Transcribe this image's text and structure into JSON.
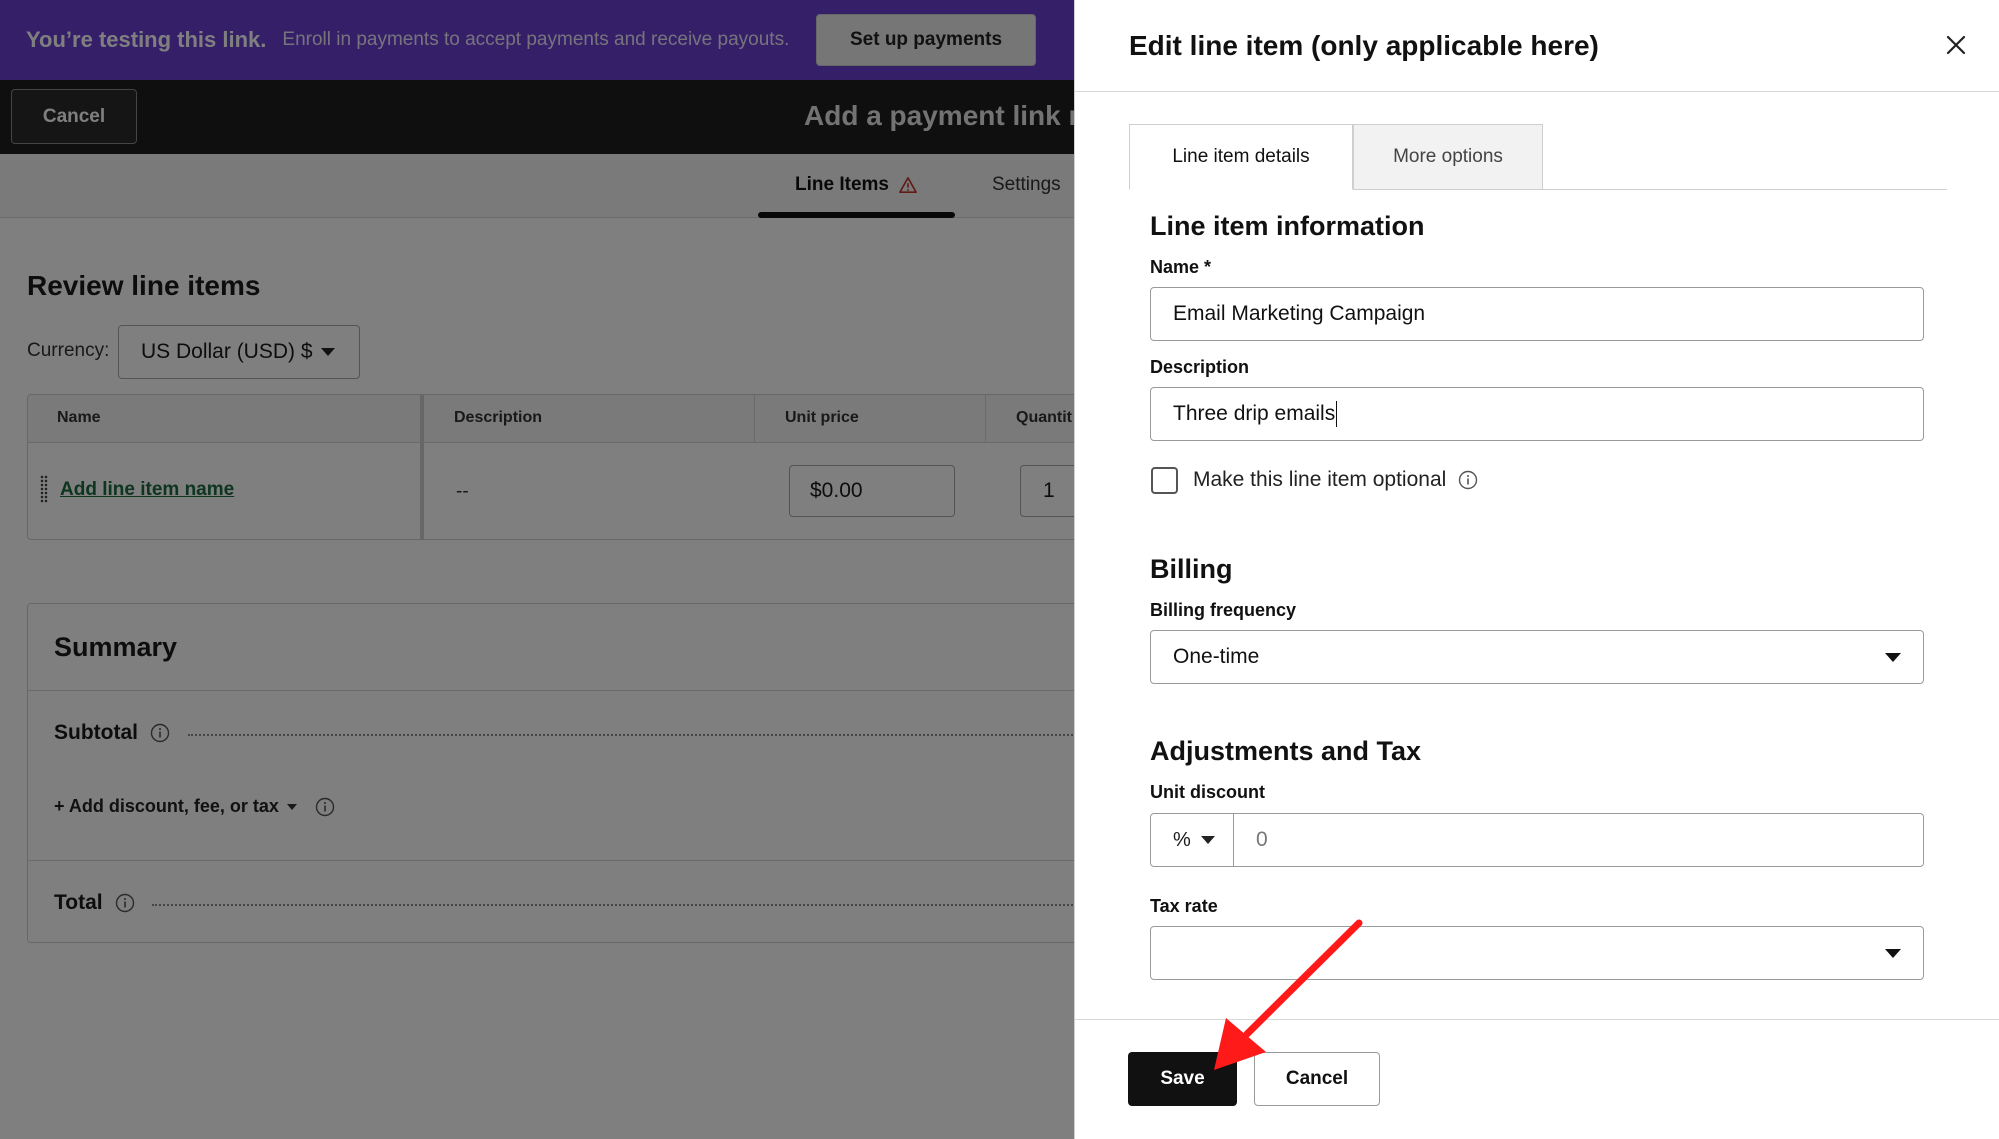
{
  "banner": {
    "strong_text": "You’re testing this link.",
    "message": "Enroll in payments to accept payments and receive payouts.",
    "setup_button": "Set up payments"
  },
  "topbar": {
    "cancel_label": "Cancel",
    "title": "Add a payment link r"
  },
  "tabs": {
    "line_items": "Line Items",
    "settings": "Settings"
  },
  "review": {
    "title": "Review line items",
    "currency_label": "Currency:",
    "currency_value": "US Dollar (USD) $"
  },
  "table": {
    "headers": [
      "Name",
      "Description",
      "Unit price",
      "Quantit"
    ],
    "row": {
      "name_link": "Add line item name",
      "description": "--",
      "unit_price": "$0.00",
      "quantity": "1"
    }
  },
  "summary": {
    "title": "Summary",
    "subtotal_label": "Subtotal",
    "add_link": "+ Add discount, fee, or tax",
    "total_label": "Total"
  },
  "panel": {
    "title": "Edit line item (only applicable here)",
    "tabs": [
      "Line item details",
      "More options"
    ],
    "section_info": "Line item information",
    "name_label": "Name *",
    "name_value": "Email Marketing Campaign",
    "description_label": "Description",
    "description_value": "Three drip emails",
    "optional_label": "Make this line item optional",
    "optional_checked": false,
    "section_billing": "Billing",
    "frequency_label": "Billing frequency",
    "frequency_value": "One-time",
    "section_adjustments": "Adjustments and Tax",
    "discount_label": "Unit discount",
    "discount_type": "%",
    "discount_value": "0",
    "tax_label": "Tax rate",
    "tax_value": "",
    "save_label": "Save",
    "cancel_label": "Cancel"
  },
  "colors": {
    "banner_bg": "#6b3fd0",
    "link_green": "#1b6b3e",
    "arrow_red": "#ff1a1a"
  }
}
